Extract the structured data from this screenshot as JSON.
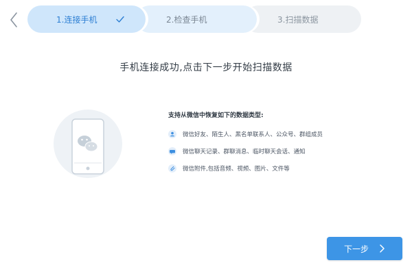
{
  "steps": [
    {
      "label": "1.连接手机",
      "state": "done"
    },
    {
      "label": "2.检查手机",
      "state": "pending"
    },
    {
      "label": "3.扫描数据",
      "state": "pending"
    }
  ],
  "main": {
    "headline": "手机连接成功,点击下一步开始扫描数据",
    "types_title": "支持从微信中恢复如下的数据类型:",
    "types": [
      {
        "icon": "contacts-icon",
        "text": "微信好友、陌生人、黑名单联系人、公众号、群组成员"
      },
      {
        "icon": "chat-bubble-icon",
        "text": "微信聊天记录、群聊消息、临时聊天会话、通知"
      },
      {
        "icon": "attachment-icon",
        "text": "微信附件,包括音频、视频、图片、文件等"
      }
    ]
  },
  "footer": {
    "next_label": "下一步"
  },
  "colors": {
    "accent": "#3d95e6",
    "step_active_bg": "#cfe6fb",
    "step_active_text": "#2d7fd3",
    "wechat_green": "#cfd8e0"
  }
}
